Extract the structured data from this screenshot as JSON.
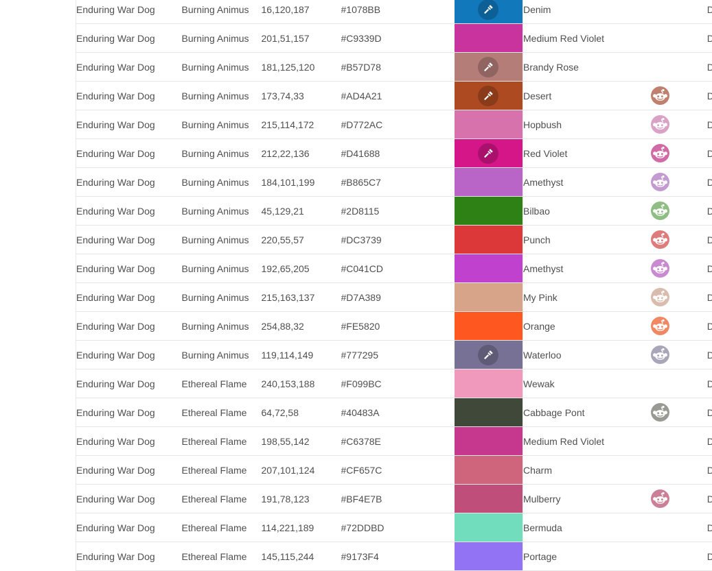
{
  "table": {
    "details_label": "Details",
    "icons": {
      "gavel": "gavel-icon",
      "badge": "reddit-alien-icon"
    },
    "rows": [
      {
        "name": "Enduring War Dog",
        "group": "Burning Animus",
        "rgb": "16,120,187",
        "hex": "#1078BB",
        "swatch": "#1078BB",
        "color_name": "Denim",
        "gavel": true,
        "badge": null
      },
      {
        "name": "Enduring War Dog",
        "group": "Burning Animus",
        "rgb": "201,51,157",
        "hex": "#C9339D",
        "swatch": "#C9339D",
        "color_name": "Medium Red Violet",
        "gavel": false,
        "badge": null
      },
      {
        "name": "Enduring War Dog",
        "group": "Burning Animus",
        "rgb": "181,125,120",
        "hex": "#B57D78",
        "swatch": "#B57D78",
        "color_name": "Brandy Rose",
        "gavel": true,
        "badge": null
      },
      {
        "name": "Enduring War Dog",
        "group": "Burning Animus",
        "rgb": "173,74,33",
        "hex": "#AD4A21",
        "swatch": "#AD4A21",
        "color_name": "Desert",
        "gavel": true,
        "badge": "#C08070"
      },
      {
        "name": "Enduring War Dog",
        "group": "Burning Animus",
        "rgb": "215,114,172",
        "hex": "#D772AC",
        "swatch": "#D772AC",
        "color_name": "Hopbush",
        "gavel": false,
        "badge": "#D9A2C6"
      },
      {
        "name": "Enduring War Dog",
        "group": "Burning Animus",
        "rgb": "212,22,136",
        "hex": "#D41688",
        "swatch": "#D41688",
        "color_name": "Red Violet",
        "gavel": true,
        "badge": "#D16BA5"
      },
      {
        "name": "Enduring War Dog",
        "group": "Burning Animus",
        "rgb": "184,101,199",
        "hex": "#B865C7",
        "swatch": "#B865C7",
        "color_name": "Amethyst",
        "gavel": false,
        "badge": "#C49BD0"
      },
      {
        "name": "Enduring War Dog",
        "group": "Burning Animus",
        "rgb": "45,129,21",
        "hex": "#2D8115",
        "swatch": "#2D8115",
        "color_name": "Bilbao",
        "gavel": false,
        "badge": "#8FBD84"
      },
      {
        "name": "Enduring War Dog",
        "group": "Burning Animus",
        "rgb": "220,55,57",
        "hex": "#DC3739",
        "swatch": "#DC3739",
        "color_name": "Punch",
        "gavel": false,
        "badge": "#DE7B7C"
      },
      {
        "name": "Enduring War Dog",
        "group": "Burning Animus",
        "rgb": "192,65,205",
        "hex": "#C041CD",
        "swatch": "#C041CD",
        "color_name": "Amethyst",
        "gavel": false,
        "badge": "#C98AD2"
      },
      {
        "name": "Enduring War Dog",
        "group": "Burning Animus",
        "rgb": "215,163,137",
        "hex": "#D7A389",
        "swatch": "#D7A389",
        "color_name": "My Pink",
        "gavel": false,
        "badge": "#D9BCAD"
      },
      {
        "name": "Enduring War Dog",
        "group": "Burning Animus",
        "rgb": "254,88,32",
        "hex": "#FE5820",
        "swatch": "#FE5820",
        "color_name": "Orange",
        "gavel": false,
        "badge": "#F08963"
      },
      {
        "name": "Enduring War Dog",
        "group": "Burning Animus",
        "rgb": "119,114,149",
        "hex": "#777295",
        "swatch": "#777295",
        "color_name": "Waterloo",
        "gavel": true,
        "badge": "#A9A6BA"
      },
      {
        "name": "Enduring War Dog",
        "group": "Ethereal Flame",
        "rgb": "240,153,188",
        "hex": "#F099BC",
        "swatch": "#F099BC",
        "color_name": "Wewak",
        "gavel": false,
        "badge": null
      },
      {
        "name": "Enduring War Dog",
        "group": "Ethereal Flame",
        "rgb": "64,72,58",
        "hex": "#40483A",
        "swatch": "#40483A",
        "color_name": "Cabbage Pont",
        "gavel": false,
        "badge": "#9A9A95"
      },
      {
        "name": "Enduring War Dog",
        "group": "Ethereal Flame",
        "rgb": "198,55,142",
        "hex": "#C6378E",
        "swatch": "#C6378E",
        "color_name": "Medium Red Violet",
        "gavel": false,
        "badge": null
      },
      {
        "name": "Enduring War Dog",
        "group": "Ethereal Flame",
        "rgb": "207,101,124",
        "hex": "#CF657C",
        "swatch": "#CF657C",
        "color_name": "Charm",
        "gavel": false,
        "badge": null
      },
      {
        "name": "Enduring War Dog",
        "group": "Ethereal Flame",
        "rgb": "191,78,123",
        "hex": "#BF4E7B",
        "swatch": "#BF4E7B",
        "color_name": "Mulberry",
        "gavel": false,
        "badge": "#CC8098"
      },
      {
        "name": "Enduring War Dog",
        "group": "Ethereal Flame",
        "rgb": "114,221,189",
        "hex": "#72DDBD",
        "swatch": "#72DDBD",
        "color_name": "Bermuda",
        "gavel": false,
        "badge": null
      },
      {
        "name": "Enduring War Dog",
        "group": "Ethereal Flame",
        "rgb": "145,115,244",
        "hex": "#9173F4",
        "swatch": "#9173F4",
        "color_name": "Portage",
        "gavel": false,
        "badge": null
      }
    ]
  }
}
